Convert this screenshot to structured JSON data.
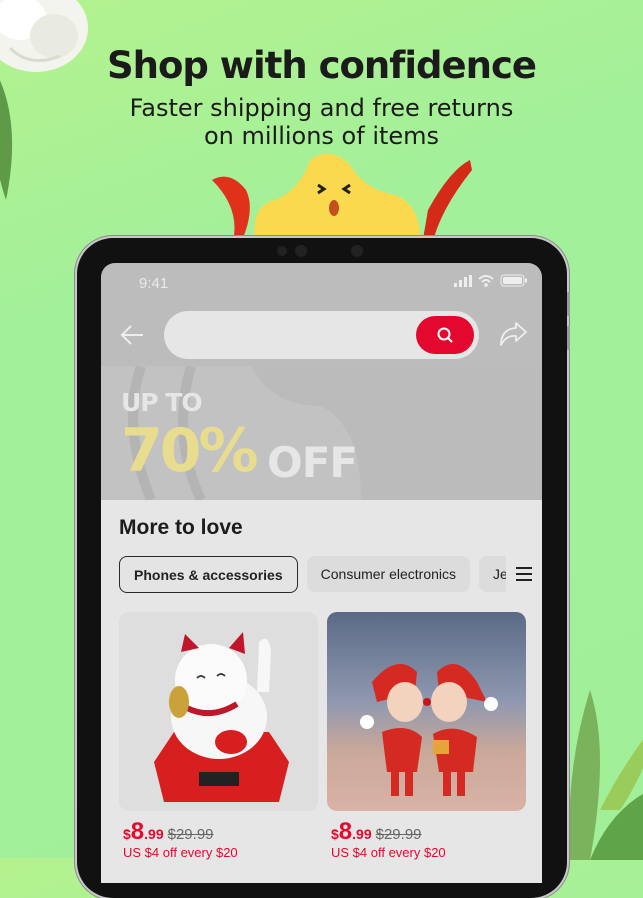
{
  "hero": {
    "headline": "Shop with confidence",
    "subline_1": "Faster shipping and free returns",
    "subline_2": "on millions of items"
  },
  "status_bar": {
    "time": "9:41",
    "icons": [
      "signal-icon",
      "wifi-icon",
      "battery-icon"
    ]
  },
  "nav": {
    "back_icon": "arrow-left-icon",
    "search_placeholder": "",
    "search_icon": "search-icon",
    "share_icon": "share-icon"
  },
  "banner": {
    "up_to": "UP TO",
    "percent": "70%",
    "off": "OFF"
  },
  "section": {
    "title": "More to love",
    "chips": [
      {
        "label": "Phones & accessories",
        "active": true
      },
      {
        "label": "Consumer electronics",
        "active": false
      },
      {
        "label": "Jewelry",
        "active": false
      }
    ],
    "menu_icon": "hamburger-menu-icon"
  },
  "products": [
    {
      "image": "lucky-cat-figurine",
      "currency": "$",
      "price_int": "8",
      "price_dec": ".99",
      "original_price": "$29.99",
      "promo": "US $4 off every $20"
    },
    {
      "image": "christmas-couple-figurines",
      "currency": "$",
      "price_int": "8",
      "price_dec": ".99",
      "original_price": "$29.99",
      "promo": "US $4 off every $20"
    }
  ],
  "colors": {
    "accent": "#e5082e",
    "background": "#a2ef9a",
    "banner_yellow": "#e8dc8e"
  }
}
